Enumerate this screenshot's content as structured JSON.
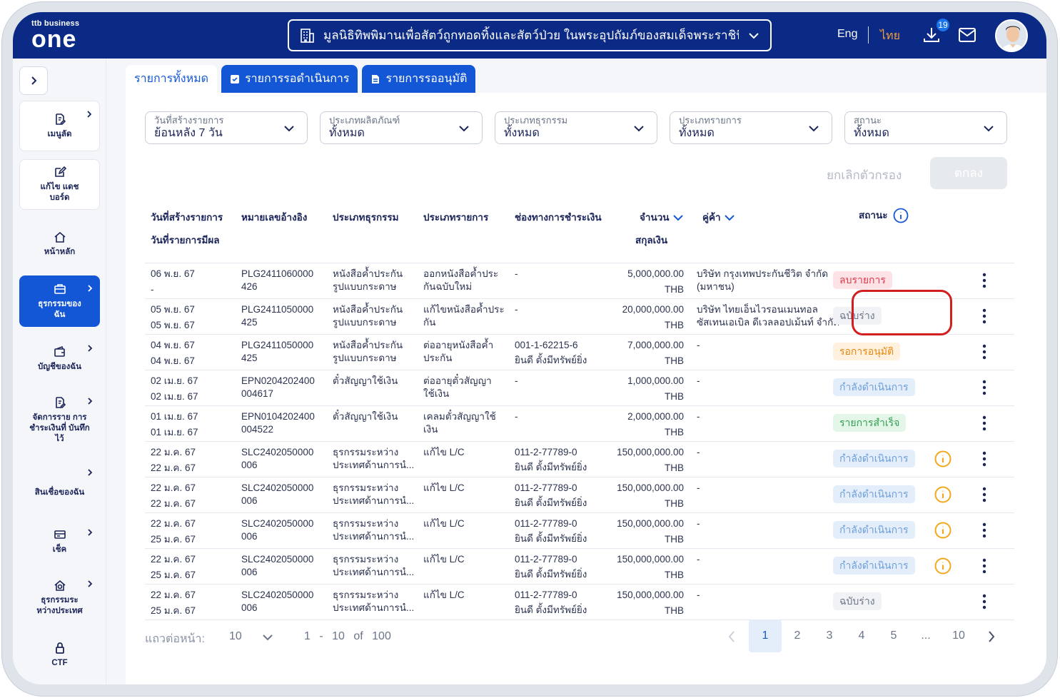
{
  "header": {
    "logo_small": "ttb business",
    "logo_big": "one",
    "org_name": "มูลนิธิทิพพิมานเพื่อสัตว์ถูกทอดทิ้งและสัตว์ป่วย ในพระอุปถัมภ์ของสมเด็จพระราชินีจุ...",
    "lang_en": "Eng",
    "lang_th": "ไทย",
    "download_badge": "19",
    "accent_color": "#0a2a85",
    "lang_active_color": "#f39c3d"
  },
  "sidebar": {
    "items": [
      {
        "label": "เมนูลัด",
        "icon": "document-edit-icon"
      },
      {
        "label": "แก้ไข แดชบอร์ด",
        "icon": "edit-icon"
      },
      {
        "label": "หน้าหลัก",
        "icon": "home-icon"
      },
      {
        "label": "ธุรกรรมของ ฉัน",
        "icon": "briefcase-icon"
      },
      {
        "label": "บัญชีของฉัน",
        "icon": "wallet-icon"
      },
      {
        "label": "จัดการราย การชำระเงินที่ บันทึกไว้",
        "icon": "document-edit-icon"
      },
      {
        "label": "สินเชื่อของฉัน",
        "icon": "loan-icon"
      },
      {
        "label": "เช็ค",
        "icon": "cheque-icon"
      },
      {
        "label": "ธุรกรรมระ หว่างประเทศ",
        "icon": "globe-home-icon"
      },
      {
        "label": "CTF",
        "icon": "lock-icon"
      }
    ]
  },
  "tabs": [
    {
      "label": "รายการทั้งหมด"
    },
    {
      "label": "รายการรอดำเนินการ"
    },
    {
      "label": "รายการรออนุมัติ"
    }
  ],
  "filters": [
    {
      "label": "วันที่สร้างรายการ",
      "value": "ย้อนหลัง 7 วัน"
    },
    {
      "label": "ประเภทผลิตภัณฑ์",
      "value": "ทั้งหมด"
    },
    {
      "label": "ประเภทธุรกรรม",
      "value": "ทั้งหมด"
    },
    {
      "label": "ประเภทรายการ",
      "value": "ทั้งหมด"
    },
    {
      "label": "สถานะ",
      "value": "ทั้งหมด"
    }
  ],
  "actions": {
    "clear": "ยกเลิกตัวกรอง",
    "ok": "ตกลง"
  },
  "table": {
    "headers": {
      "created": "วันที่สร้างรายการ",
      "effective": "วันที่รายการมีผล",
      "ref": "หมายเลขอ้างอิง",
      "txn_type": "ประเภทธุรกรรม",
      "item_type": "ประเภทรายการ",
      "channel": "ช่องทางการชำระเงิน",
      "amount": "จำนวน",
      "currency": "สกุลเงิน",
      "party": "คู่ค้า",
      "status": "สถานะ"
    },
    "rows": [
      {
        "d1": "06 พ.ย. 67",
        "d2": "-",
        "ref1": "PLG2411060000",
        "ref2": "426",
        "t1": "หนังสือค้ำประกัน",
        "t2": "รูปแบบกระดาษ",
        "i1": "ออกหนังสือค้ำประ",
        "i2": "กันฉบับใหม่",
        "c1": "-",
        "c2": "",
        "amt": "5,000,000.00",
        "cur": "THB",
        "p1": "บริษัท กรุงเทพประกันชีวิต จำกัด",
        "p2": "(มหาชน)",
        "status": "ลบรายการ",
        "style": "red",
        "warn": false
      },
      {
        "d1": "05 พ.ย. 67",
        "d2": "05 พ.ย. 67",
        "ref1": "PLG2411050000",
        "ref2": "425",
        "t1": "หนังสือค้ำประกัน",
        "t2": "รูปแบบกระดาษ",
        "i1": "แก้ไขหนังสือค้ำประ",
        "i2": "กัน",
        "c1": "-",
        "c2": "",
        "amt": "20,000,000.00",
        "cur": "THB",
        "p1": "บริษัท ไทยเอ็นไวรอนเมนทอล",
        "p2": "ซัสเทนเอเบิล ดีเวลลอปเม้นท์ จำกัด",
        "status": "ฉบับร่าง",
        "style": "gray",
        "warn": false
      },
      {
        "d1": "04 พ.ย. 67",
        "d2": "04 พ.ย. 67",
        "ref1": "PLG2411050000",
        "ref2": "425",
        "t1": "หนังสือค้ำประกัน",
        "t2": "รูปแบบกระดาษ",
        "i1": "ต่ออายุหนังสือค้ำ",
        "i2": "ประกัน",
        "c1": "001-1-62215-6",
        "c2": "ยินดี ตั้งมีทรัพย์ยิ่ง",
        "amt": "7,000,000.00",
        "cur": "THB",
        "p1": "-",
        "p2": "",
        "status": "รอการอนุมัติ",
        "style": "orange",
        "warn": false
      },
      {
        "d1": "02 เม.ย. 67",
        "d2": "02 เม.ย. 67",
        "ref1": "EPN0204202400",
        "ref2": "004617",
        "t1": "ตั๋วสัญญาใช้เงิน",
        "t2": "",
        "i1": "ต่ออายุตั๋วสัญญา",
        "i2": "ใช้เงิน",
        "c1": "-",
        "c2": "",
        "amt": "1,000,000.00",
        "cur": "THB",
        "p1": "-",
        "p2": "",
        "status": "กำลังดำเนินการ",
        "style": "blue",
        "warn": false
      },
      {
        "d1": "01 เม.ย. 67",
        "d2": "01 เม.ย. 67",
        "ref1": "EPN0104202400",
        "ref2": "004522",
        "t1": "ตั๋วสัญญาใช้เงิน",
        "t2": "",
        "i1": "เคลมตั๋วสัญญาใช้",
        "i2": "เงิน",
        "c1": "-",
        "c2": "",
        "amt": "2,000,000.00",
        "cur": "THB",
        "p1": "-",
        "p2": "",
        "status": "รายการสำเร็จ",
        "style": "green",
        "warn": false
      },
      {
        "d1": "22 ม.ค. 67",
        "d2": "22 ม.ค. 67",
        "ref1": "SLC2402050000",
        "ref2": "006",
        "t1": "ธุรกรรมระหว่าง",
        "t2": "ประเทศด้านการนํ...",
        "i1": "แก้ไข L/C",
        "i2": "",
        "c1": "011-2-77789-0",
        "c2": "ยินดี ตั้งมีทรัพย์ยิ่ง",
        "amt": "150,000,000.00",
        "cur": "THB",
        "p1": "-",
        "p2": "",
        "status": "กำลังดำเนินการ",
        "style": "blue",
        "warn": true
      },
      {
        "d1": "22 ม.ค. 67",
        "d2": "22 ม.ค. 67",
        "ref1": "SLC2402050000",
        "ref2": "006",
        "t1": "ธุรกรรมระหว่าง",
        "t2": "ประเทศด้านการนํ...",
        "i1": "แก้ไข L/C",
        "i2": "",
        "c1": "011-2-77789-0",
        "c2": "ยินดี ตั้งมีทรัพย์ยิ่ง",
        "amt": "150,000,000.00",
        "cur": "THB",
        "p1": "-",
        "p2": "",
        "status": "กำลังดำเนินการ",
        "style": "blue",
        "warn": true
      },
      {
        "d1": "22 ม.ค. 67",
        "d2": "25 ม.ค. 67",
        "ref1": "SLC2402050000",
        "ref2": "006",
        "t1": "ธุรกรรมระหว่าง",
        "t2": "ประเทศด้านการนํ...",
        "i1": "แก้ไข L/C",
        "i2": "",
        "c1": "011-2-77789-0",
        "c2": "ยินดี ตั้งมีทรัพย์ยิ่ง",
        "amt": "150,000,000.00",
        "cur": "THB",
        "p1": "-",
        "p2": "",
        "status": "กำลังดำเนินการ",
        "style": "blue",
        "warn": true
      },
      {
        "d1": "22 ม.ค. 67",
        "d2": "25 ม.ค. 67",
        "ref1": "SLC2402050000",
        "ref2": "006",
        "t1": "ธุรกรรมระหว่าง",
        "t2": "ประเทศด้านการนํ...",
        "i1": "แก้ไข L/C",
        "i2": "",
        "c1": "011-2-77789-0",
        "c2": "ยินดี ตั้งมีทรัพย์ยิ่ง",
        "amt": "150,000,000.00",
        "cur": "THB",
        "p1": "-",
        "p2": "",
        "status": "กำลังดำเนินการ",
        "style": "blue",
        "warn": true
      },
      {
        "d1": "22 ม.ค. 67",
        "d2": "25 ม.ค. 67",
        "ref1": "SLC2402050000",
        "ref2": "006",
        "t1": "ธุรกรรมระหว่าง",
        "t2": "ประเทศด้านการนํ...",
        "i1": "แก้ไข L/C",
        "i2": "",
        "c1": "011-2-77789-0",
        "c2": "ยินดี ตั้งมีทรัพย์ยิ่ง",
        "amt": "150,000,000.00",
        "cur": "THB",
        "p1": "-",
        "p2": "",
        "status": "ฉบับร่าง",
        "style": "gray",
        "warn": false
      }
    ]
  },
  "pagination": {
    "rows_label": "แถวต่อหน้า:",
    "rows_per_page": "10",
    "range": "1 - 10 of 100",
    "pages": [
      "1",
      "2",
      "3",
      "4",
      "5",
      "...",
      "10"
    ],
    "current": "1"
  }
}
